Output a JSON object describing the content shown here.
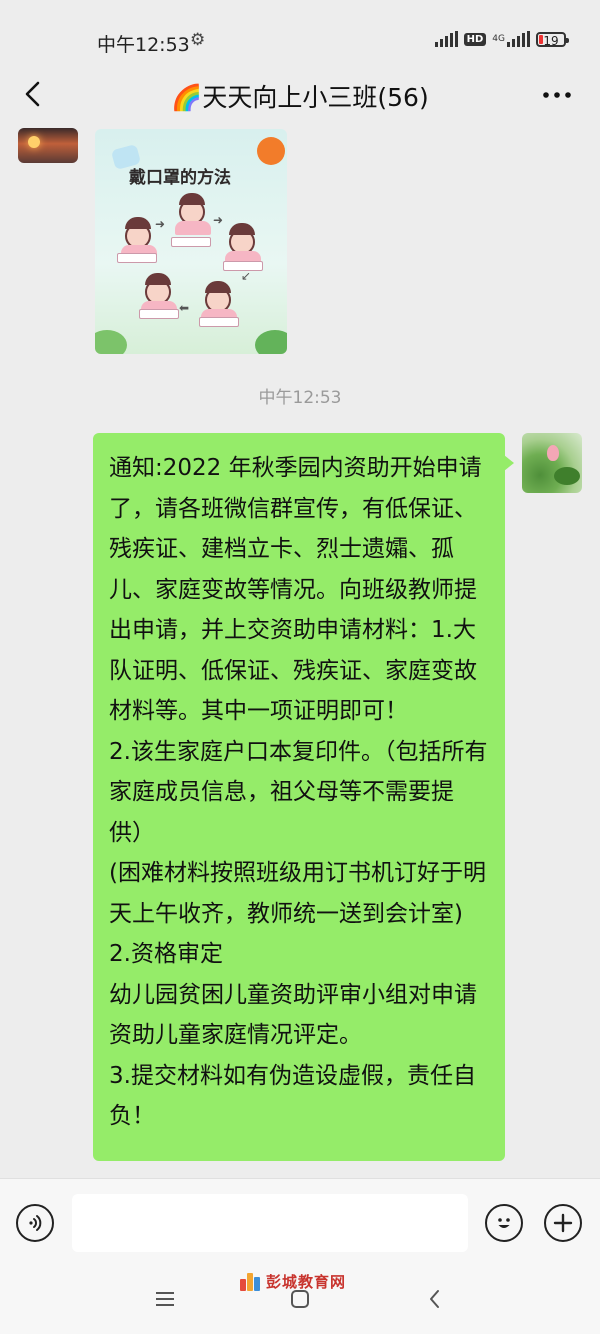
{
  "status_bar": {
    "time": "中午12:53",
    "network": "4G",
    "hd": "HD",
    "battery": "19"
  },
  "header": {
    "title": "🌈天天向上小三班(56)"
  },
  "messages": {
    "image_message": {
      "image_title": "戴口罩的方法"
    },
    "timestamp": "中午12:53",
    "text_message": "通知:2022 年秋季园内资助开始申请了，请各班微信群宣传，有低保证、残疾证、建档立卡、烈士遗孀、孤儿、家庭变故等情况。向班级教师提出申请，并上交资助申请材料：1.大队证明、低保证、残疾证、家庭变故材料等。其中一项证明即可！\n2.该生家庭户口本复印件。（包括所有家庭成员信息，祖父母等不需要提供）\n(困难材料按照班级用订书机订好于明天上午收齐，教师统一送到会计室)\n2.资格审定\n幼儿园贫困儿童资助评审小组对申请资助儿童家庭情况评定。\n3.提交材料如有伪造设虚假，责任自负！"
  },
  "watermark": {
    "text": "彭城教育网"
  },
  "colors": {
    "bubble_green": "#95ec69",
    "background": "#ededed",
    "watermark_red": "#c8342e"
  }
}
